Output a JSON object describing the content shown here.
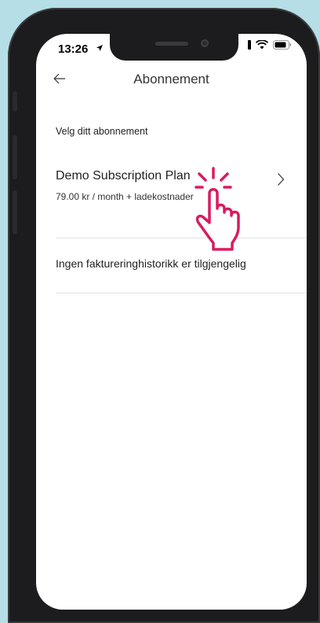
{
  "status": {
    "time": "13:26"
  },
  "header": {
    "title": "Abonnement"
  },
  "section_label": "Velg ditt abonnement",
  "plan": {
    "name": "Demo Subscription Plan",
    "price": "79.00 kr / month + ladekostnader"
  },
  "billing_history_empty": "Ingen faktureringhistorikk er tilgjengelig",
  "colors": {
    "background": "#b5dee6",
    "hand_accent": "#d81b60"
  },
  "icons": [
    "arrow-left-icon",
    "chevron-right-icon",
    "tap-hand-icon",
    "location-arrow-icon",
    "signal-icon",
    "wifi-icon",
    "battery-icon"
  ]
}
